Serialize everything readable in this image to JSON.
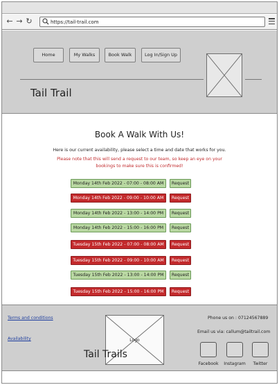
{
  "browser": {
    "url": "https://tail-trail.com"
  },
  "header": {
    "nav": [
      "Home",
      "My Walks",
      "Book Walk",
      "Log In/Sign Up"
    ],
    "site_title": "Tail Trail"
  },
  "main": {
    "heading": "Book A Walk With Us!",
    "intro": "Here is our current availability, please select a time and date that works for you.",
    "note_line1": "Please note that this will send a request to our team, so keep an eye on your",
    "note_line2": "bookings to make sure this is confirmed!",
    "slots": [
      {
        "label": "Monday 14th Feb 2022 -  07:00 - 08:00 AM",
        "status": "available",
        "request": "Request"
      },
      {
        "label": "Monday 14th Feb 2022 -  09:00 - 10:00 AM",
        "status": "unavailable",
        "request": "Request"
      },
      {
        "label": "Monday 14th Feb 2022 -  13:00 - 14:00 PM",
        "status": "available",
        "request": "Request"
      },
      {
        "label": "Monday 14th Feb 2022 -  15:00 - 16:00 PM",
        "status": "available",
        "request": "Request"
      },
      {
        "label": "Tuesday 15th Feb 2022 -  07:00 - 08:00 AM",
        "status": "unavailable",
        "request": "Request"
      },
      {
        "label": "Tuesday 15th Feb 2022 -  09:00 - 10:00 AM",
        "status": "unavailable",
        "request": "Request"
      },
      {
        "label": "Tuesday 15th Feb 2022 -  13:00 - 14:00 PM",
        "status": "available",
        "request": "Request"
      },
      {
        "label": "Tuesday 15th Feb 2022 -  15:00 - 16:00 PM",
        "status": "unavailable",
        "request": "Request"
      }
    ]
  },
  "footer": {
    "terms": "Terms and conditions",
    "availability": "Availability",
    "logo": "Logo",
    "title": "Tail Trails",
    "phone": "Phone us on : 07124567889",
    "email": "Email us via: callum@tailtrail.com",
    "social": [
      "Facebook",
      "Instagram",
      "Twitter"
    ]
  },
  "colors": {
    "available": "#b9d8a2",
    "unavailable": "#c32a2c",
    "chrome": "#cfcfcf",
    "link": "#1d3d9e",
    "note": "#c0282a"
  },
  "icons": [
    "back-arrow-icon",
    "forward-arrow-icon",
    "refresh-icon",
    "search-icon",
    "hamburger-menu-icon"
  ]
}
